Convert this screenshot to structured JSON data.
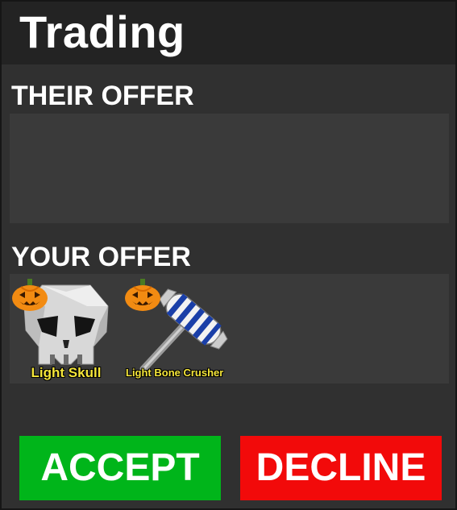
{
  "window": {
    "title": "Trading"
  },
  "their_offer": {
    "label": "THEIR OFFER",
    "items": []
  },
  "your_offer": {
    "label": "YOUR OFFER",
    "items": [
      {
        "name": "Light Skull",
        "icon": "skull-icon",
        "badge": "pumpkin-icon"
      },
      {
        "name": "Light Bone Crusher",
        "icon": "hammer-icon",
        "badge": "pumpkin-icon"
      }
    ]
  },
  "buttons": {
    "accept_label": "ACCEPT",
    "decline_label": "DECLINE"
  },
  "colors": {
    "accept": "#00b51a",
    "decline": "#f20a0a",
    "item_name": "#f5e63a",
    "panel": "#3a3a3a",
    "background": "#303030"
  }
}
